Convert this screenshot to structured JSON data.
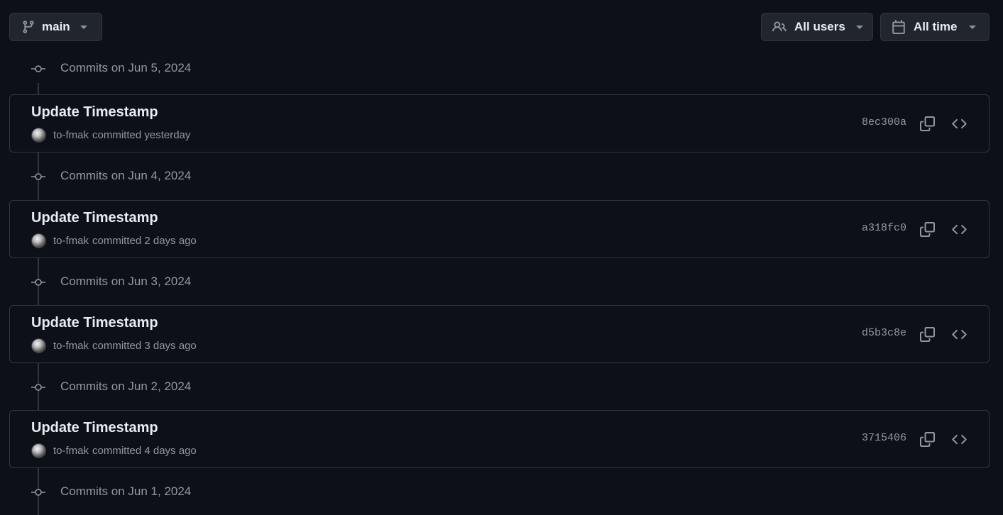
{
  "toolbar": {
    "branch_label": "main",
    "branch_icon": "git-branch-icon",
    "users_label": "All users",
    "users_icon": "people-icon",
    "time_label": "All time",
    "time_icon": "calendar-icon"
  },
  "colors": {
    "background": "#0d1117",
    "border": "#30363d",
    "button_bg": "#21262d",
    "text_primary": "#e6edf3",
    "text_muted": "#9198a1"
  },
  "dates": [
    {
      "label": "Commits on Jun 5, 2024"
    },
    {
      "label": "Commits on Jun 4, 2024"
    },
    {
      "label": "Commits on Jun 3, 2024"
    },
    {
      "label": "Commits on Jun 2, 2024"
    },
    {
      "label": "Commits on Jun 1, 2024"
    }
  ],
  "commits": [
    {
      "title": "Update Timestamp",
      "author": "to-fmak",
      "when": "committed yesterday",
      "sha": "8ec300a"
    },
    {
      "title": "Update Timestamp",
      "author": "to-fmak",
      "when": "committed 2 days ago",
      "sha": "a318fc0"
    },
    {
      "title": "Update Timestamp",
      "author": "to-fmak",
      "when": "committed 3 days ago",
      "sha": "d5b3c8e"
    },
    {
      "title": "Update Timestamp",
      "author": "to-fmak",
      "when": "committed 4 days ago",
      "sha": "3715406"
    }
  ]
}
